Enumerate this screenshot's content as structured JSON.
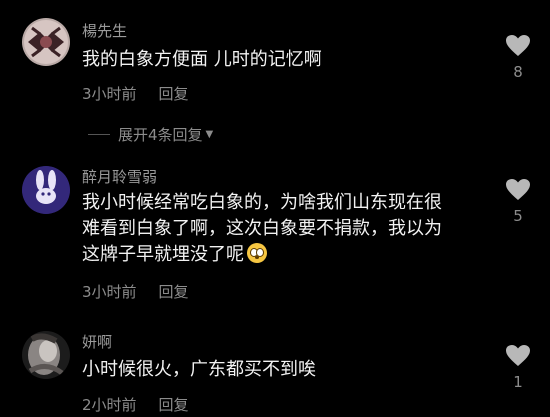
{
  "comments": [
    {
      "username": "楊先生",
      "text_lines": [
        "我的白象方便面 儿时的记忆啊"
      ],
      "time": "3小时前",
      "reply_label": "回复",
      "likes": "8"
    },
    {
      "username": "醉月聆雪弱",
      "text_lines": [
        "我小时候经常吃白象的，为啥我们山东现在很",
        "难看到白象了啊，这次白象要不捐款，我以为",
        "这牌子早就埋没了呢"
      ],
      "emoji": "flushed-face-emoji",
      "time": "3小时前",
      "reply_label": "回复",
      "likes": "5"
    },
    {
      "username": "妍啊",
      "text_lines": [
        "小时候很火，广东都买不到唉"
      ],
      "time": "2小时前",
      "reply_label": "回复",
      "likes": "1"
    }
  ],
  "expand_replies": {
    "label": "展开4条回复"
  },
  "colors": {
    "background": "#000000",
    "username": "#9a9a9a",
    "text": "#f2f2f2",
    "meta": "#8c8c8c"
  }
}
